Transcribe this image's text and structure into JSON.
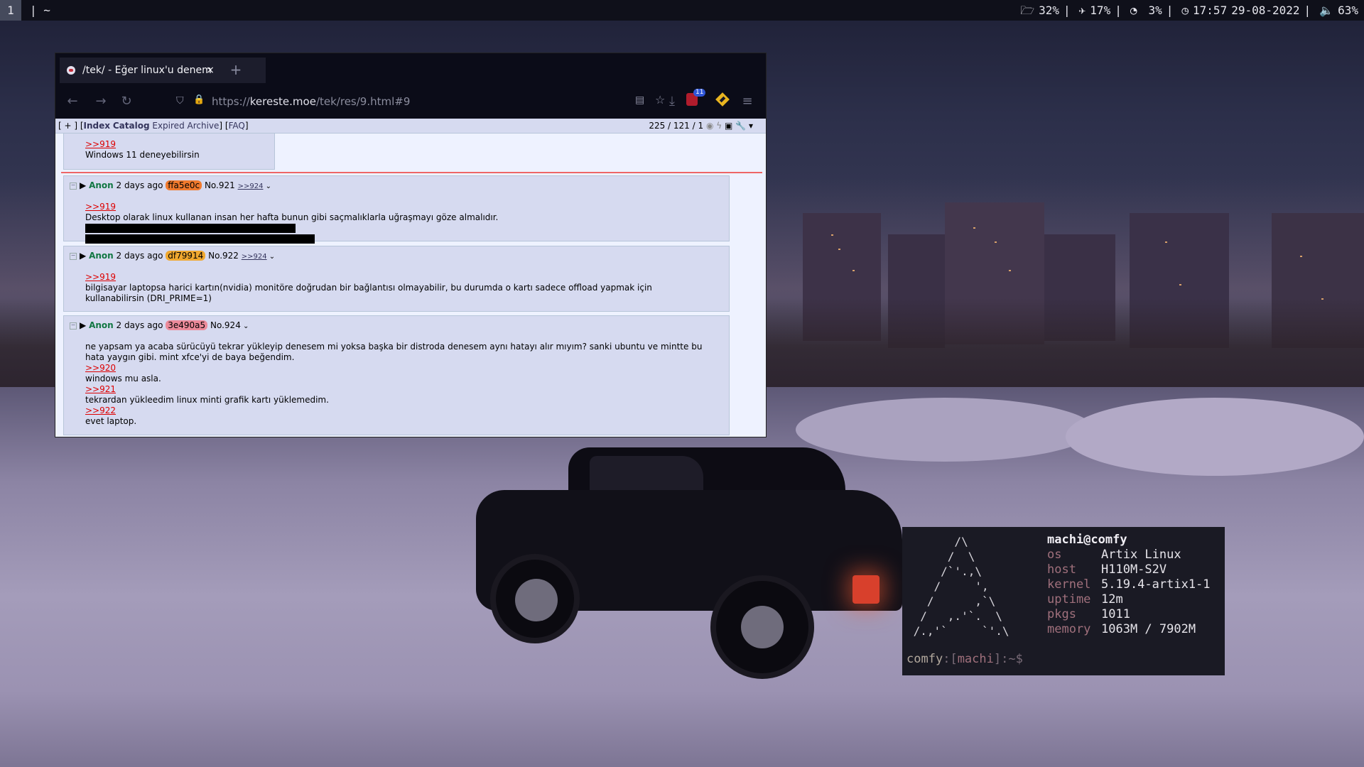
{
  "topbar": {
    "workspace": "1",
    "title_sep": "|",
    "title": "~",
    "disk_icon": "folder-icon",
    "disk": "32%",
    "cpu_icon": "plane-icon",
    "cpu": "17%",
    "mem_icon": "gauge-icon",
    "mem": "3%",
    "clock_icon": "clock-icon",
    "time": "17:57",
    "date": "29-08-2022",
    "vol_icon": "speaker-icon",
    "volume": "63%",
    "sep": "|"
  },
  "browser": {
    "tab_title": "/tek/ - Eğer linux'u denem",
    "tab_close": "×",
    "new_tab": "+",
    "url_scheme": "https://",
    "url_host": "kereste.moe",
    "url_path": "/tek/res/9.html#9",
    "ublock_count": "11"
  },
  "board": {
    "nav_left_open": "[ + ] [",
    "nav_index": "Index",
    "nav_catalog": "Catalog",
    "nav_expired": "Expired",
    "nav_archive": "Archive",
    "nav_close": "] [",
    "nav_faq": "FAQ",
    "nav_end": "]",
    "stats": "225 / 121 / 1"
  },
  "posts": [
    {
      "quote": ">>919",
      "text": "Windows 11 deneyebilirsin"
    },
    {
      "name": "Anon",
      "time": "2 days ago",
      "id": "ffa5e0c",
      "id_color": "#f07a2e",
      "no": "No.921",
      "backlink": ">>924",
      "quote": ">>919",
      "text": "Desktop olarak linux kullanan insan her hafta bunun gibi saçmalıklarla uğraşmayı göze almalıdır."
    },
    {
      "name": "Anon",
      "time": "2 days ago",
      "id": "df79914",
      "id_color": "#f0a830",
      "no": "No.922",
      "backlink": ">>924",
      "quote": ">>919",
      "text": "bilgisayar laptopsa harici kartın(nvidia) monitöre doğrudan bir bağlantısı olmayabilir, bu durumda o kartı sadece offload yapmak için kullanabilirsin (DRI_PRIME=1)"
    },
    {
      "name": "Anon",
      "time": "2 days ago",
      "id": "3e490a5",
      "id_color": "#ec8a9a",
      "no": "No.924",
      "text1": "ne yapsam ya acaba sürücüyü tekrar yükleyip denesem mi yoksa başka bir distroda denesem aynı hatayı alır mıyım? sanki ubuntu ve mintte bu hata yaygın gibi. mint xfce'yi de baya beğendim.",
      "quote1": ">>920",
      "text2": "windows mu asla.",
      "quote2": ">>921",
      "text3": "tekrardan yükleedim linux minti grafik kartı yüklemedim.",
      "quote3": ">>922",
      "text4": "evet laptop."
    }
  ],
  "terminal": {
    "user_host": "machi@comfy",
    "ascii": "       /\\\n      /  \\\n     /`'.,\\\n    /     ',\n   /      ,`\\\n  /   ,.'`.  \\\n /.,'`     `'.\\",
    "rows": [
      {
        "k": "os",
        "v": "Artix Linux"
      },
      {
        "k": "host",
        "v": "H110M-S2V"
      },
      {
        "k": "kernel",
        "v": "5.19.4-artix1-1"
      },
      {
        "k": "uptime",
        "v": "12m"
      },
      {
        "k": "pkgs",
        "v": "1011"
      },
      {
        "k": "memory",
        "v": "1063M / 7902M"
      }
    ],
    "prompt_host": "comfy",
    "prompt_colon": ":",
    "prompt_open": "[",
    "prompt_user": "machi",
    "prompt_close": "]",
    "prompt_tail": ":~$"
  }
}
